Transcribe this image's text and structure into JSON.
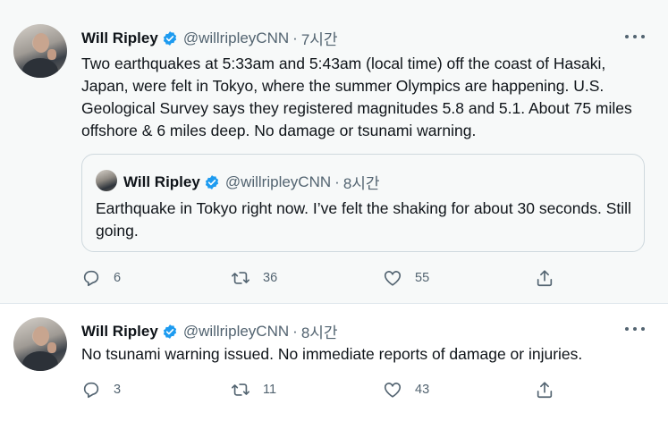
{
  "tweets": [
    {
      "author_name": "Will Ripley",
      "handle": "@willripleyCNN",
      "separator": "·",
      "time": "7시간",
      "text": "Two earthquakes at 5:33am and 5:43am (local time) off the coast of Hasaki, Japan, were felt in Tokyo, where the summer Olympics are happening. U.S. Geological Survey says they registered magnitudes 5.8 and 5.1. About 75 miles offshore & 6 miles deep. No damage or tsunami warning.",
      "quoted": {
        "author_name": "Will Ripley",
        "handle": "@willripleyCNN",
        "separator": "·",
        "time": "8시간",
        "text": "Earthquake in Tokyo right now. I’ve felt the shaking for about 30 seconds. Still going."
      },
      "replies": "6",
      "retweets": "36",
      "likes": "55"
    },
    {
      "author_name": "Will Ripley",
      "handle": "@willripleyCNN",
      "separator": "·",
      "time": "8시간",
      "text": "No tsunami warning issued. No immediate reports of damage or injuries.",
      "replies": "3",
      "retweets": "11",
      "likes": "43"
    }
  ],
  "icons": {
    "verified": "verified-badge-icon",
    "more": "more-options-icon",
    "reply": "reply-icon",
    "retweet": "retweet-icon",
    "like": "like-icon",
    "share": "share-icon"
  },
  "colors": {
    "verified_blue": "#1d9bf0",
    "secondary_text": "#536471",
    "highlighted_background": "#f7f9f9"
  }
}
